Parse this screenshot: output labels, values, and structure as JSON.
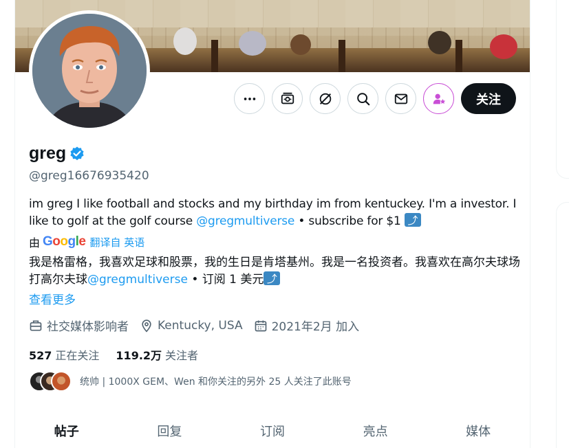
{
  "profile": {
    "name": "greg",
    "handle": "@greg16676935420",
    "bio_en_part1": "im greg I like football and stocks and my birthday im from kentuckey. I'm a investor. I like to golf at the golf course ",
    "bio_en_link": "@gregmultiverse",
    "bio_en_part2": " • subscribe for $1 ",
    "translate_by": "由",
    "translate_brand": "Google",
    "translate_label": "翻译自 英语",
    "bio_zh_part1": "我是格雷格，我喜欢足球和股票，我的生日是肯塔基州。我是一名投资者。我喜欢在高尔夫球场打高尔夫球",
    "bio_zh_link": "@gregmultiverse",
    "bio_zh_part2": " • 订阅 1 美元",
    "see_more": "查看更多",
    "category": "社交媒体影响者",
    "location": "Kentucky, USA",
    "joined": "2021年2月 加入",
    "following_count": "527",
    "following_label": "正在关注",
    "followers_count": "119.2万",
    "followers_label": "关注者",
    "followed_by_text": "统帅 | 1000X GEM、Wen 和你关注的另外 25 人关注了此账号"
  },
  "actions": {
    "follow_label": "关注",
    "icons": [
      "more-icon",
      "subscribe-icon",
      "grok-icon",
      "search-icon",
      "message-icon",
      "subscriber-star-icon"
    ]
  },
  "tabs": [
    {
      "label": "帖子",
      "active": true
    },
    {
      "label": "回复",
      "active": false
    },
    {
      "label": "订阅",
      "active": false
    },
    {
      "label": "亮点",
      "active": false
    },
    {
      "label": "媒体",
      "active": false
    }
  ],
  "colors": {
    "accent": "#1d9bf0",
    "text_primary": "#0f1419",
    "text_secondary": "#536471",
    "border": "#cfd9de",
    "follow_bg": "#0f1419",
    "subscriber_purple": "#c94fd6",
    "verified": "#1d9bf0"
  }
}
